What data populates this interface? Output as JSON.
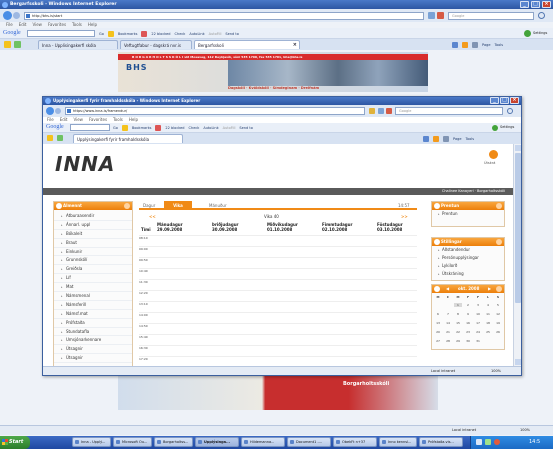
{
  "outer": {
    "title": "Bergarfsskoli - Windows Internet Explorer",
    "address": "http://bhs.is/start",
    "search_placeholder": "Google",
    "menu": [
      "File",
      "Edit",
      "View",
      "Favorites",
      "Tools",
      "Help"
    ],
    "google_label": "Google",
    "toolbar": [
      "Go",
      "Bookmarks",
      "22 blocked",
      "Check",
      "AutoLink",
      "AutoFill",
      "Send to"
    ],
    "settings": "Settings",
    "tabs": [
      "Inna - Upplisingakerfi skóla",
      "Veftugtfabur - dagskrá nvr.is",
      "Bergarfsskoli"
    ],
    "right_tools": [
      "Page",
      "Tools"
    ],
    "banner_line": "B O R G A R H O L T S S K Ó L I   við Mosaveg, 112 Reykjavík, sími 535 1700, fax 535 1701, bhs@bhs.is",
    "banner_sub": "Dagskóli · Kvöldskóli · Símdeginam · Dreifnám",
    "banner_logo": "BHS",
    "status_zone": "Local intranet",
    "zoom": "100%",
    "bottom_brand": "Borgarholtsskóli"
  },
  "inner": {
    "title": "Upplýsingakerfi fyrir framhaldsskóla - Windows Internet Explorer",
    "address": "https://www.inna.is/framendur/",
    "search_placeholder": "Google",
    "menu": [
      "File",
      "Edit",
      "View",
      "Favorites",
      "Tools",
      "Help"
    ],
    "google_label": "Google",
    "toolbar": [
      "Go",
      "Bookmarks",
      "22 blocked",
      "Check",
      "AutoLink",
      "AutoFill",
      "Send to"
    ],
    "settings": "Settings",
    "tab": "Upplýsingakerfi fyrir framhaldsskóla",
    "right_tools": [
      "Page",
      "Tools"
    ],
    "logo": "INNA",
    "help_label": "Útskrá",
    "user_line": "Chalinee Kanayeri  ·  Borgarholtsskóli",
    "status_zone": "Local intranet",
    "zoom": "100%"
  },
  "left_panel": {
    "header": "Almennt",
    "items": [
      "Atburaasendir",
      "Ánnarl. uppl",
      "Bókaleit",
      "Braut",
      "Einkunir",
      "Grunnskólí",
      "Greiðsla",
      "Líf",
      "Mat",
      "Námsmenal",
      "Námsferill",
      "Námsf.mat",
      "Prófstaða",
      "Stundataflа",
      "Umsjónarkennare",
      "Útsagnir",
      "Útsagnir"
    ]
  },
  "calendar_tabs": [
    "Dagur",
    "Vika",
    "Mánuður"
  ],
  "calendar": {
    "active_tab": "Vika",
    "time": "14:57",
    "prev": "<<",
    "next": ">>",
    "week_label": "Vika  40",
    "time_col_label": "Tími",
    "days": [
      {
        "name": "Mánudagur",
        "date": "29.09.2008"
      },
      {
        "name": "Þriðjudagur",
        "date": "30.09.2008"
      },
      {
        "name": "Miðvikudagur",
        "date": "01.10.2008"
      },
      {
        "name": "Fimmtudagur",
        "date": "02.10.2008"
      },
      {
        "name": "Föstudagur",
        "date": "03.10.2008"
      }
    ],
    "times": [
      "08:10",
      "09:00",
      "09:50",
      "10:40",
      "11:30",
      "12:20",
      "13:10",
      "14:00",
      "14:50",
      "15:40",
      "16:30",
      "17:20"
    ]
  },
  "right_panels": {
    "printer_header": "Prentun",
    "printer_items": [
      "Prentun"
    ],
    "settings_header": "Stillingar",
    "settings_items": [
      "Aðstandendur",
      "Persónupplýsingar",
      "Lykilorð",
      "Útskráning"
    ],
    "cal_month": "okt. 2008",
    "cal_weekdays": [
      "M",
      "Þ",
      "M",
      "F",
      "F",
      "L",
      "S"
    ],
    "cal_days": [
      "",
      "",
      "1",
      "2",
      "3",
      "4",
      "5",
      "6",
      "7",
      "8",
      "9",
      "10",
      "11",
      "12",
      "13",
      "14",
      "15",
      "16",
      "17",
      "18",
      "19",
      "20",
      "21",
      "22",
      "23",
      "24",
      "25",
      "26",
      "27",
      "28",
      "29",
      "30",
      "31",
      "",
      ""
    ]
  },
  "taskbar": {
    "start": "Start",
    "buttons": [
      "Inna - Upplý...",
      "Microsoft Ou...",
      "Borgarholtss...",
      "Upplýsinga...",
      "Hildemanna...",
      "Document1 -...",
      "ObekFt n+37",
      "Inno kennsl...",
      "Prófstaða.vis..."
    ],
    "active_index": 3,
    "clock": "14:5"
  },
  "colors": {
    "accent": "#f08a16",
    "titlebar": "#2d56a3",
    "outer_bg": "#eef2f8"
  }
}
